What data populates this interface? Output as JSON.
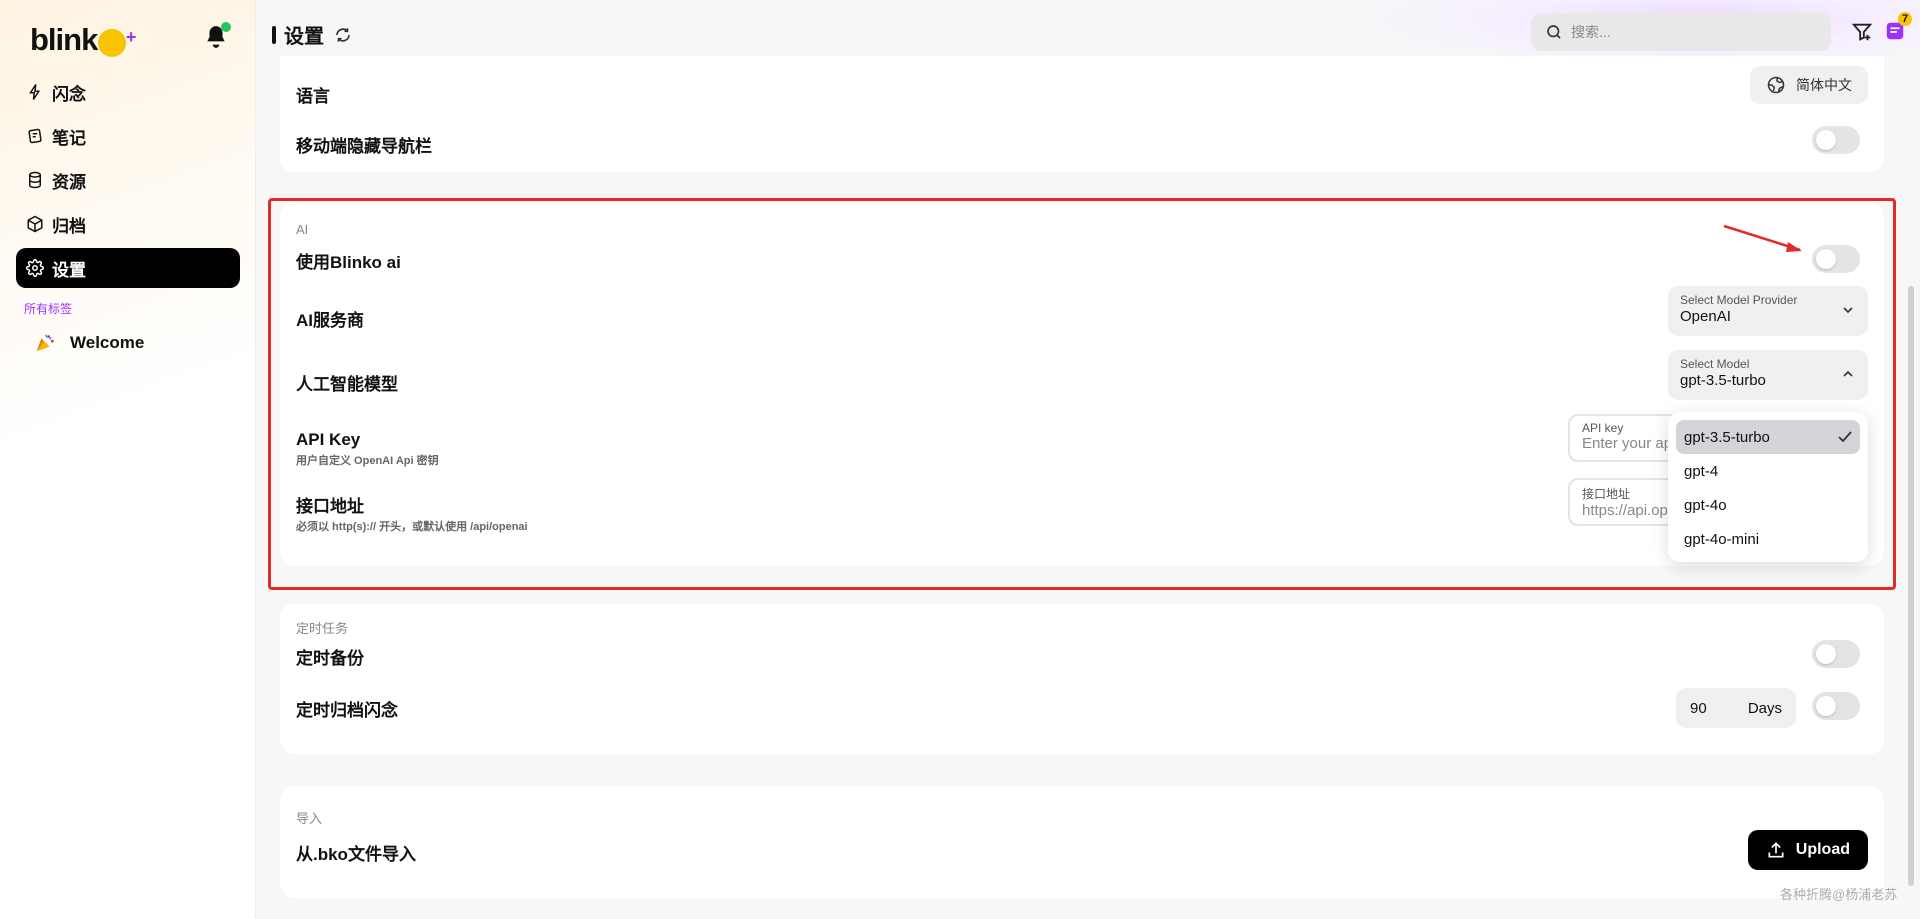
{
  "app": {
    "logo": "blink",
    "logo_o": "o",
    "logo_plus": "+"
  },
  "header": {
    "title": "设置",
    "search_placeholder": "搜索...",
    "notifications_badge": "7"
  },
  "sidebar": {
    "items": [
      {
        "label": "闪念",
        "icon": "flash-icon"
      },
      {
        "label": "笔记",
        "icon": "notes-icon"
      },
      {
        "label": "资源",
        "icon": "database-icon"
      },
      {
        "label": "归档",
        "icon": "archive-box-icon"
      },
      {
        "label": "设置",
        "icon": "gear-icon",
        "active": true
      }
    ],
    "tags_heading": "所有标签",
    "tags": [
      {
        "label": "Welcome",
        "icon": "party-popper-icon"
      }
    ]
  },
  "general": {
    "language_label": "语言",
    "language_value": "简体中文",
    "hide_mobile_nav_label": "移动端隐藏导航栏"
  },
  "ai": {
    "section": "AI",
    "use_blinko_ai": "使用Blinko ai",
    "provider_label": "AI服务商",
    "provider_caption": "Select Model Provider",
    "provider_value": "OpenAI",
    "model_label": "人工智能模型",
    "model_caption": "Select Model",
    "model_value": "gpt-3.5-turbo",
    "model_options": [
      "gpt-3.5-turbo",
      "gpt-4",
      "gpt-4o",
      "gpt-4o-mini"
    ],
    "api_key_label": "API Key",
    "api_key_desc": "用户自定义 OpenAI Api 密钥",
    "api_key_caption": "API key",
    "api_key_placeholder": "Enter your api key",
    "endpoint_label": "接口地址",
    "endpoint_desc": "必须以 http(s):// 开头，或默认使用 /api/openai",
    "endpoint_caption": "接口地址",
    "endpoint_placeholder": "https://api.openai.com"
  },
  "tasks": {
    "section": "定时任务",
    "backup_label": "定时备份",
    "archive_label": "定时归档闪念",
    "archive_days_value": "90",
    "archive_days_unit": "Days"
  },
  "import": {
    "section": "导入",
    "bko_label": "从.bko文件导入",
    "upload_label": "Upload"
  },
  "watermark": "各种折腾@杨浦老苏",
  "colors": {
    "accent": "#9b30ff",
    "highlight": "#e12a2a",
    "logo_yellow": "#f6c400"
  }
}
